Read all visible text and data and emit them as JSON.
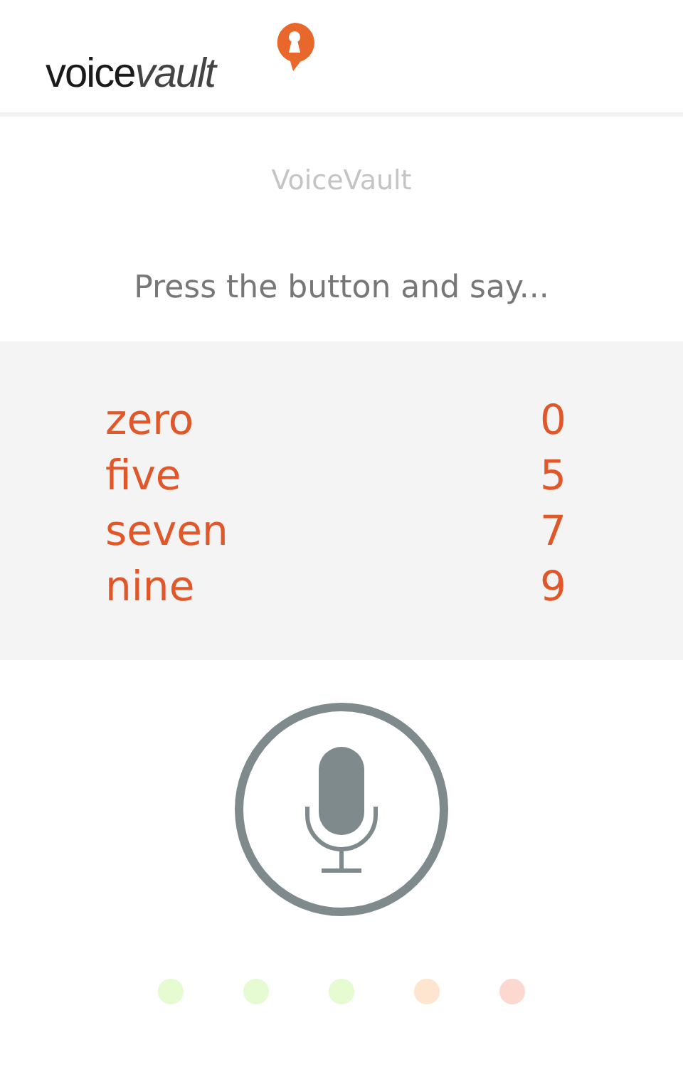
{
  "header": {
    "logo_start": "voice",
    "logo_end": "vault"
  },
  "title": "VoiceVault",
  "prompt": "Press the button and say...",
  "digits": [
    {
      "word": "zero",
      "number": "0"
    },
    {
      "word": "five",
      "number": "5"
    },
    {
      "word": "seven",
      "number": "7"
    },
    {
      "word": "nine",
      "number": "9"
    }
  ],
  "dots": [
    {
      "color": "#e6fbd2"
    },
    {
      "color": "#e6fbd2"
    },
    {
      "color": "#e6fbd2"
    },
    {
      "color": "#fde5cf"
    },
    {
      "color": "#fcd8d0"
    }
  ]
}
